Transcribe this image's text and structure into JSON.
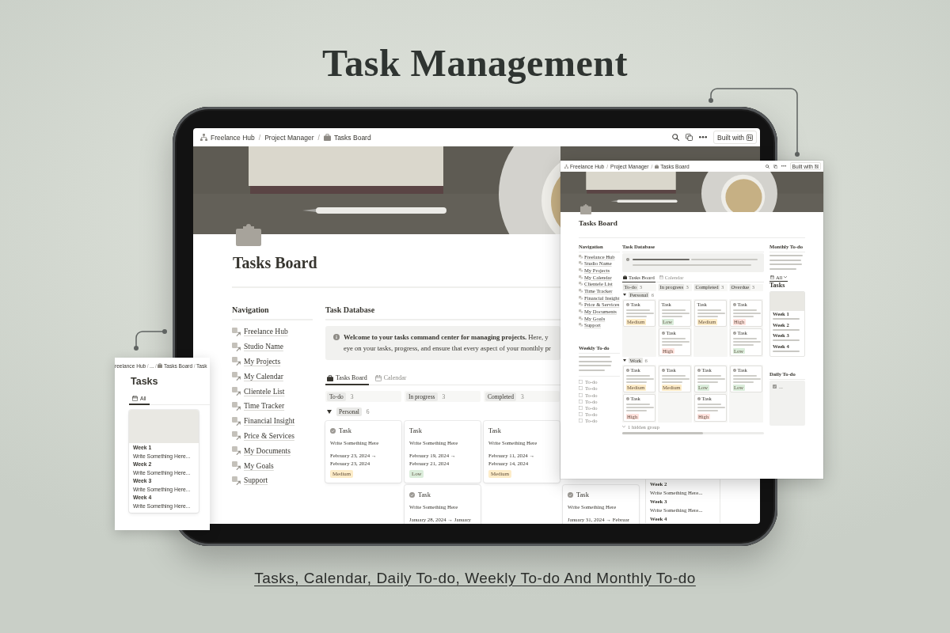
{
  "headline": "Task Management",
  "tablet": {
    "breadcrumb": {
      "separator": "/",
      "items": [
        {
          "label": "Freelance Hub",
          "kind": "workspace"
        },
        {
          "label": "Project Manager",
          "kind": "page"
        },
        {
          "label": "Tasks Board",
          "kind": "board"
        }
      ]
    },
    "share_button": "Built with",
    "title": "Tasks Board",
    "navigation": {
      "heading": "Navigation",
      "items": [
        "Freelance Hub",
        "Studio Name",
        "My Projects",
        "My Calendar",
        "Clientele List",
        "Time Tracker",
        "Financial Insight",
        "Price & Services",
        "My Documents",
        "My Goals",
        "Support"
      ]
    },
    "database": {
      "heading": "Task Database",
      "callout_lines": [
        "**Welcome to your tasks command center for managing projects.** Here, y",
        "eye on your tasks, progress, and ensure that every aspect of your monthly pr"
      ],
      "views": [
        {
          "label": "Tasks Board",
          "kind": "board",
          "selected": true
        },
        {
          "label": "Calendar",
          "kind": "calendar",
          "selected": false
        }
      ],
      "columns": [
        {
          "label": "To-do",
          "count": "3"
        },
        {
          "label": "In progress",
          "count": "3"
        },
        {
          "label": "Completed",
          "count": "3"
        }
      ],
      "group": {
        "label": "Personal",
        "count": "6",
        "expanded": true
      },
      "lanes": [
        [
          {
            "marked": true,
            "title": "Task",
            "note": "Write Something Here",
            "dates": "February 23, 2024 →\nFebruary 23, 2024",
            "tag": {
              "label": "Medium",
              "color": "#fdecc8"
            }
          }
        ],
        [
          {
            "marked": false,
            "title": "Task",
            "note": "Write Something Here",
            "dates": "February 19, 2024 →\nFebruary 21, 2024",
            "tag": {
              "label": "Low",
              "color": "#dbeddb"
            }
          },
          {
            "marked": true,
            "title": "Task",
            "note": "Write Something Here",
            "dates": "January 28, 2024 → January"
          }
        ],
        [
          {
            "marked": false,
            "title": "Task",
            "note": "Write Something Here",
            "dates": "February 11, 2024 →\nFebruary 14, 2024",
            "tag": {
              "label": "Medium",
              "color": "#fdecc8"
            }
          }
        ],
        [
          {
            "marked": true,
            "title": "Task",
            "note": "Write Something Here",
            "dates": "January 31, 2024 → Februar"
          }
        ]
      ]
    },
    "monthly_gallery_lines": [
      {
        "kind": "heading",
        "text": "Week 2"
      },
      {
        "kind": "note",
        "text": "Write Something Here..."
      },
      {
        "kind": "heading",
        "text": "Week 3"
      },
      {
        "kind": "note",
        "text": "Write Something Here..."
      },
      {
        "kind": "heading",
        "text": "Week 4"
      }
    ]
  },
  "side_panel": {
    "breadcrumb": {
      "separator": "/",
      "items": [
        {
          "label": "reelance Hub",
          "kind": "page"
        },
        {
          "label": "...",
          "kind": "page"
        },
        {
          "label": "Tasks Board",
          "kind": "board"
        },
        {
          "label": "Task",
          "kind": "page"
        }
      ]
    },
    "title": "Tasks",
    "views": [
      {
        "label": "All",
        "selected": true
      }
    ],
    "gallery_lines": [
      {
        "kind": "heading",
        "text": "Week 1"
      },
      {
        "kind": "note",
        "text": "Write Something Here..."
      },
      {
        "kind": "heading",
        "text": "Week 2"
      },
      {
        "kind": "note",
        "text": "Write Something Here..."
      },
      {
        "kind": "heading",
        "text": "Week 3"
      },
      {
        "kind": "note",
        "text": "Write Something Here..."
      },
      {
        "kind": "heading",
        "text": "Week 4"
      },
      {
        "kind": "note",
        "text": "Write Something Here..."
      }
    ]
  },
  "detail_panel": {
    "breadcrumb": {
      "separator": "/",
      "items": [
        {
          "label": "Freelance Hub",
          "kind": "workspace"
        },
        {
          "label": "Project Manager",
          "kind": "page"
        },
        {
          "label": "Tasks Board",
          "kind": "board"
        }
      ]
    },
    "share_button": "Built with",
    "title": "Tasks Board",
    "navigation": {
      "heading": "Navigation",
      "items": [
        "Freelance Hub",
        "Studio Name",
        "My Projects",
        "My Calendar",
        "Clientele List",
        "Time Tracker",
        "Financial Insight",
        "Price & Services",
        "My Documents",
        "My Goals",
        "Support"
      ]
    },
    "weekly": {
      "heading": "Weekly To-do",
      "todos": [
        {
          "label": "To-do",
          "checked": false
        },
        {
          "label": "To-do",
          "checked": false
        },
        {
          "label": "To-do",
          "checked": false
        },
        {
          "label": "To-do",
          "checked": false
        },
        {
          "label": "To-do",
          "checked": false
        },
        {
          "label": "To-do",
          "checked": false
        },
        {
          "label": "To-do",
          "checked": false
        }
      ]
    },
    "database": {
      "heading": "Task Database",
      "views": [
        {
          "label": "Tasks Board",
          "kind": "board",
          "selected": true
        },
        {
          "label": "Calendar",
          "kind": "calendar",
          "selected": false
        }
      ],
      "columns": [
        {
          "label": "To-do",
          "count": "3"
        },
        {
          "label": "In progress",
          "count": "3"
        },
        {
          "label": "Completed",
          "count": "3"
        },
        {
          "label": "Overdue",
          "count": "3"
        }
      ],
      "groups": [
        {
          "label": "Personal",
          "count": "6",
          "expanded": true,
          "lanes": [
            [
              {
                "marked": true,
                "title": "Task",
                "tag": {
                  "label": "Medium",
                  "color": "#fdecc8"
                }
              }
            ],
            [
              {
                "marked": false,
                "title": "Task",
                "tag": {
                  "label": "Low",
                  "color": "#dbeddb"
                }
              },
              {
                "marked": true,
                "title": "Task",
                "tag": {
                  "label": "High",
                  "color": "#ffe2dd"
                }
              }
            ],
            [
              {
                "marked": false,
                "title": "Task",
                "tag": {
                  "label": "Medium",
                  "color": "#fdecc8"
                }
              }
            ],
            [
              {
                "marked": true,
                "title": "Task",
                "tag": {
                  "label": "High",
                  "color": "#ffe2dd"
                }
              },
              {
                "marked": true,
                "title": "Task",
                "tag": {
                  "label": "Low",
                  "color": "#dbeddb"
                }
              }
            ]
          ]
        },
        {
          "label": "Work",
          "count": "6",
          "expanded": true,
          "lanes": [
            [
              {
                "marked": true,
                "title": "Task",
                "tag": {
                  "label": "Medium",
                  "color": "#fdecc8"
                }
              },
              {
                "marked": true,
                "title": "Task",
                "tag": {
                  "label": "High",
                  "color": "#ffe2dd"
                }
              }
            ],
            [
              {
                "marked": true,
                "title": "Task",
                "tag": {
                  "label": "Medium",
                  "color": "#fdecc8"
                }
              }
            ],
            [
              {
                "marked": true,
                "title": "Task",
                "tag": {
                  "label": "Low",
                  "color": "#dbeddb"
                }
              },
              {
                "marked": true,
                "title": "Task",
                "tag": {
                  "label": "High",
                  "color": "#ffe2dd"
                }
              }
            ],
            [
              {
                "marked": true,
                "title": "Task",
                "tag": {
                  "label": "Low",
                  "color": "#dbeddb"
                }
              }
            ]
          ]
        }
      ],
      "hidden_groups": "1 hidden group"
    },
    "monthly": {
      "heading": "Monthly To-do",
      "views": [
        {
          "label": "All",
          "selected": true
        }
      ],
      "gallery_title": "Tasks",
      "weeks": [
        "Week 1",
        "Week 2",
        "Week 3",
        "Week 4"
      ]
    },
    "daily": {
      "heading": "Daily To-do",
      "items": [
        {
          "label": "...",
          "checked": true
        }
      ]
    }
  },
  "caption": "Tasks, Calendar, Daily To-do, Weekly To-do And Monthly To-do"
}
